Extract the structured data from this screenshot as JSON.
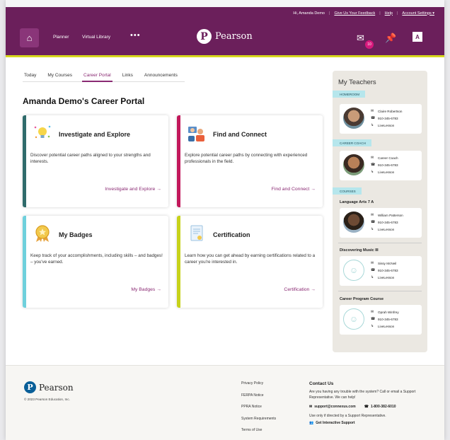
{
  "util": {
    "greeting": "Hi, Amanda Demo",
    "feedback": "Give Us Your Feedback",
    "help": "Help",
    "account": "Account Settings ▾"
  },
  "nav": {
    "planner": "Planner",
    "library": "Virtual Library",
    "more": "•••",
    "brand": "Pearson",
    "mail_count": "10"
  },
  "tabs": [
    "Today",
    "My Courses",
    "Career Portal",
    "Links",
    "Announcements"
  ],
  "active_tab": "Career Portal",
  "page_title": "Amanda Demo's Career Portal",
  "cards": [
    {
      "title": "Investigate and Explore",
      "desc": "Discover potential career paths aligned to your strengths and interests.",
      "cta": "Investigate and Explore →",
      "accent": "#2f6b6b"
    },
    {
      "title": "Find and Connect",
      "desc": "Explore potential career paths by connecting with experienced professionals in the field.",
      "cta": "Find and Connect →",
      "accent": "#c2185b"
    },
    {
      "title": "My Badges",
      "desc": "Keep track of your accomplishments, including skills – and badges! – you've earned.",
      "cta": "My Badges →",
      "accent": "#6fd0dc"
    },
    {
      "title": "Certification",
      "desc": "Learn how you can get ahead by earning certifications related to a career you're interested in.",
      "cta": "Certification →",
      "accent": "#c7d21a"
    }
  ],
  "teachers": {
    "heading": "My Teachers",
    "homeroom_label": "HOMEROOM",
    "coach_label": "CAREER COACH",
    "courses_label": "COURSES",
    "homeroom": {
      "name": "Claire Robertson",
      "phone": "910-345-6783",
      "lesson": "LiveLesson"
    },
    "coach": {
      "name": "Career Coach",
      "phone": "910-345-6783",
      "lesson": "LiveLesson"
    },
    "courses": [
      {
        "course": "Language Arts 7 A",
        "name": "William Patterson",
        "phone": "910-345-6783",
        "lesson": "LiveLesson"
      },
      {
        "course": "Discovering Music III",
        "name": "Sissy McNeil",
        "phone": "910-345-6783",
        "lesson": "LiveLesson"
      },
      {
        "course": "Career Program Course",
        "name": "Oprah Winfrey",
        "phone": "910-345-6783",
        "lesson": "LiveLesson"
      }
    ]
  },
  "footer": {
    "brand": "Pearson",
    "copyright": "© 2023 Pearson Education, Inc.",
    "links": [
      "Privacy Policy",
      "FERPA Notice",
      "PPRA Notice",
      "System Requirements",
      "Terms of Use"
    ],
    "contact_heading": "Contact Us",
    "contact_text": "Are you having any trouble with the system? Call or email a Support Representative. We can help!",
    "email": "support@connexus.com",
    "phone": "1-800-382-6010",
    "note": "Use only if directed by a Support Representative.",
    "support_link": "Get Interactive Support"
  }
}
